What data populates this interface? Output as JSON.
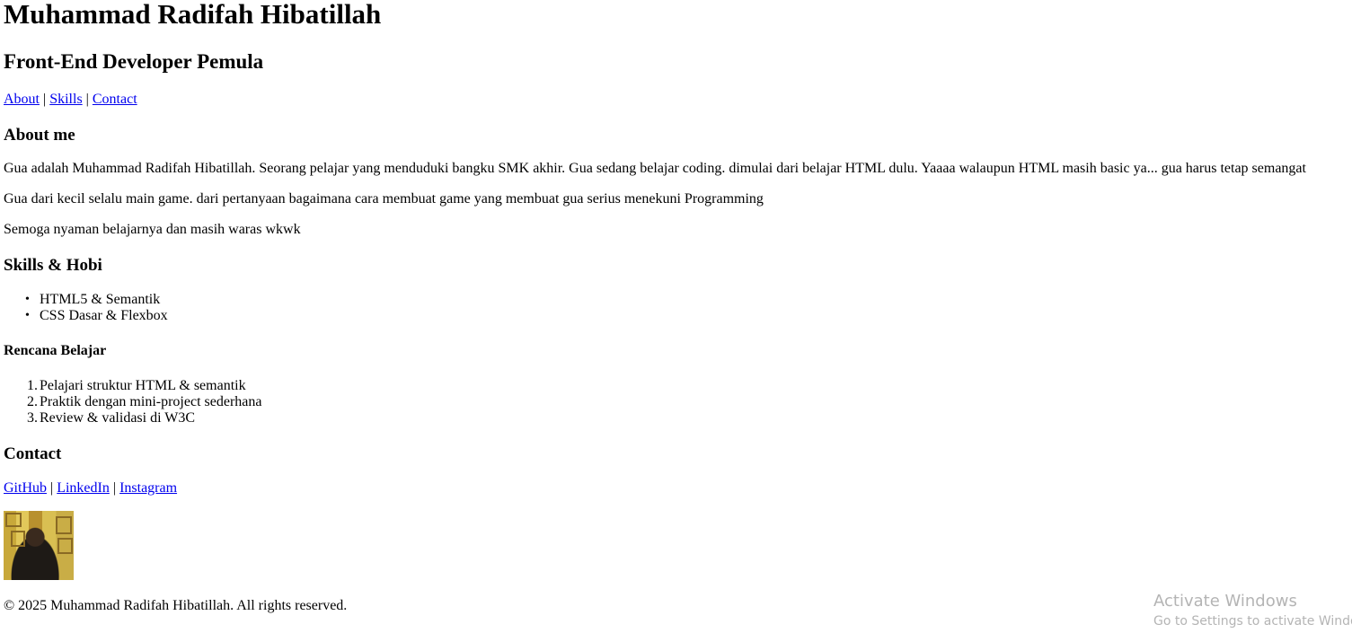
{
  "header": {
    "name": "Muhammad Radifah Hibatillah",
    "role": "Front-End Developer Pemula"
  },
  "nav": {
    "links": [
      "About",
      "Skills",
      "Contact"
    ],
    "separator": "|"
  },
  "about": {
    "heading": "About me",
    "paragraphs": [
      "Gua adalah Muhammad Radifah Hibatillah. Seorang pelajar yang menduduki bangku SMK akhir. Gua sedang belajar coding. dimulai dari belajar HTML dulu. Yaaaa walaupun HTML masih basic ya... gua harus tetap semangat",
      "Gua dari kecil selalu main game. dari pertanyaan bagaimana cara membuat game yang membuat gua serius menekuni Programming",
      "Semoga nyaman belajarnya dan masih waras wkwk"
    ]
  },
  "skills": {
    "heading": "Skills & Hobi",
    "items": [
      "HTML5 & Semantik",
      "CSS Dasar & Flexbox"
    ]
  },
  "plan": {
    "heading": "Rencana Belajar",
    "items": [
      "Pelajari struktur HTML & semantik",
      "Praktik dengan mini-project sederhana",
      "Review & validasi di W3C"
    ]
  },
  "contact": {
    "heading": "Contact",
    "links": [
      "GitHub",
      "LinkedIn",
      "Instagram"
    ],
    "separator": "|"
  },
  "footer": {
    "copyright": "© 2025 Muhammad Radifah Hibatillah. All rights reserved."
  },
  "watermark": {
    "title": "Activate Windows",
    "subtitle": "Go to Settings to activate Windows."
  }
}
